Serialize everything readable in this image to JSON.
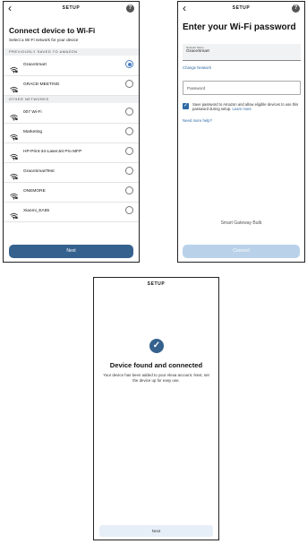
{
  "screen1": {
    "header_title": "SETUP",
    "heading": "Connect device to Wi-Fi",
    "subtitle": "Select a Wi-Fi network for your device",
    "saved_section": "PREVIOUSLY SAVED TO AMAZON",
    "other_section": "OTHER NETWORKS",
    "saved_networks": [
      {
        "name": "GraceSmart",
        "selected": true
      },
      {
        "name": "GRACE-MEETING",
        "selected": false
      }
    ],
    "other_networks": [
      {
        "name": "007 Wi-Fi"
      },
      {
        "name": "Marketing"
      },
      {
        "name": "HP-Print-34-LaserJet Pro MFP"
      },
      {
        "name": "GraceSmartTest"
      },
      {
        "name": "ONEMORE"
      },
      {
        "name": "Xiaomi_EA55"
      }
    ],
    "next_label": "Next"
  },
  "screen2": {
    "heading": "Enter your Wi-Fi password",
    "network_label": "Network Name",
    "network_value": "GraceSmart",
    "change_network": "Change Network",
    "password_placeholder": "Password",
    "save_text": "Save password to Amazon and allow eligible devices to use this password during setup.",
    "learn_more": "Learn more",
    "need_help": "Need more help?",
    "device_name": "Smart Gateway Bulb",
    "connect_label": "Connect"
  },
  "screen3": {
    "header_title": "SETUP",
    "heading": "Device found and connected",
    "body": "Your device has been added to your Alexa account. Next, set the device up for easy use.",
    "next_label": "Next"
  },
  "colors": {
    "primary": "#35618e",
    "primary_disabled": "#b9d2e9",
    "link": "#2d6aa5"
  }
}
